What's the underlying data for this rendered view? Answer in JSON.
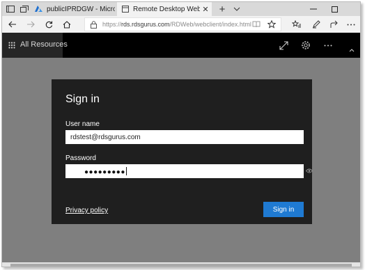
{
  "browser": {
    "tabs": [
      {
        "title": "publicIPRDGW - Microsoft",
        "active": false
      },
      {
        "title": "Remote Desktop Web (",
        "active": true
      }
    ],
    "address": {
      "prefix": "https://",
      "host": "rds.rdsgurus.com",
      "path": "/RDWeb/webclient/index.html"
    }
  },
  "appbar": {
    "resources_label": "All Resources"
  },
  "signin": {
    "title": "Sign in",
    "username_label": "User name",
    "username_value": "rdstest@rdsgurus.com",
    "password_label": "Password",
    "password_mask": "●●●●●●●●●",
    "privacy_link": "Privacy policy",
    "button_label": "Sign in"
  },
  "colors": {
    "primary_button": "#1f7ad2",
    "dialog_bg": "#1f1f1f",
    "workspace_bg": "#7f7f7f"
  },
  "icons": [
    "tab-list-icon",
    "tab-switch-icon",
    "azure-icon",
    "page-icon",
    "close-icon",
    "new-tab-icon",
    "chevron-down-icon",
    "minimize-icon",
    "maximize-icon",
    "back-arrow-icon",
    "forward-arrow-icon",
    "refresh-icon",
    "home-icon",
    "lock-icon",
    "reading-view-icon",
    "star-icon",
    "favorites-icon",
    "pen-icon",
    "share-icon",
    "more-icon",
    "grid-icon",
    "expand-icon",
    "gear-icon",
    "ellipsis-icon",
    "collapse-chevron-icon",
    "reveal-password-icon"
  ]
}
